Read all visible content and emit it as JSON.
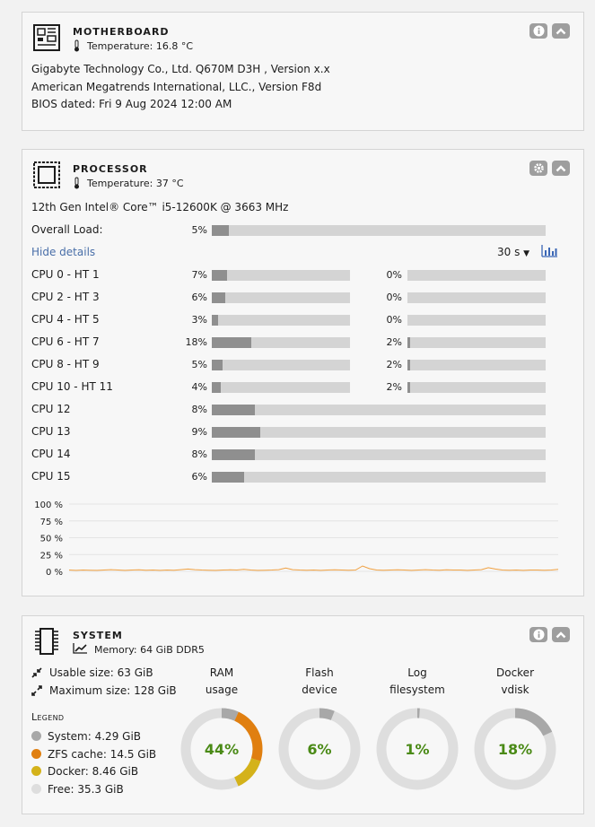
{
  "motherboard": {
    "title": "MOTHERBOARD",
    "temperature": "Temperature: 16.8 °C",
    "lines": [
      "Gigabyte Technology Co., Ltd. Q670M D3H , Version x.x",
      "American Megatrends International, LLC., Version F8d",
      "BIOS dated: Fri 9 Aug 2024 12:00 AM"
    ],
    "icons": [
      "info-icon",
      "chevron-up-icon"
    ]
  },
  "processor": {
    "title": "PROCESSOR",
    "temperature": "Temperature: 37 °C",
    "model": "12th Gen Intel® Core™ i5-12600K @ 3663 MHz",
    "overall": {
      "label": "Overall Load:",
      "pct_text": "5%",
      "value": 5
    },
    "hide_details": "Hide details",
    "interval": "30 s",
    "cpu_rows": [
      {
        "label": "CPU 0 - HT 1",
        "a_text": "7%",
        "a": 7,
        "b_text": "0%",
        "b": 0
      },
      {
        "label": "CPU 2 - HT 3",
        "a_text": "6%",
        "a": 6,
        "b_text": "0%",
        "b": 0
      },
      {
        "label": "CPU 4 - HT 5",
        "a_text": "3%",
        "a": 3,
        "b_text": "0%",
        "b": 0
      },
      {
        "label": "CPU 6 - HT 7",
        "a_text": "18%",
        "a": 18,
        "b_text": "2%",
        "b": 2
      },
      {
        "label": "CPU 8 - HT 9",
        "a_text": "5%",
        "a": 5,
        "b_text": "2%",
        "b": 2
      },
      {
        "label": "CPU 10 - HT 11",
        "a_text": "4%",
        "a": 4,
        "b_text": "2%",
        "b": 2
      }
    ],
    "cpu_single": [
      {
        "label": "CPU 12",
        "a_text": "8%",
        "a": 8
      },
      {
        "label": "CPU 13",
        "a_text": "9%",
        "a": 9
      },
      {
        "label": "CPU 14",
        "a_text": "8%",
        "a": 8
      },
      {
        "label": "CPU 15",
        "a_text": "6%",
        "a": 6
      }
    ],
    "icons": [
      "gear-icon",
      "chevron-up-icon",
      "bar-chart-icon"
    ]
  },
  "chart_data": {
    "type": "line",
    "yticks": [
      "100 %",
      "75 %",
      "50 %",
      "25 %",
      "0 %"
    ],
    "ylim": [
      0,
      100
    ],
    "grid": true,
    "series": [
      {
        "color": "#f0a040",
        "values": [
          2,
          1.5,
          2,
          1.8,
          1.5,
          2,
          2.5,
          2,
          1.5,
          2,
          2.2,
          1.8,
          2,
          1.5,
          2,
          1.8,
          2.5,
          3.5,
          2.5,
          2,
          1.8,
          1.5,
          2,
          2.2,
          2,
          3,
          2,
          1.5,
          1.8,
          2,
          2.5,
          5,
          2.5,
          2,
          1.8,
          2,
          1.5,
          2,
          2.2,
          2,
          1.8,
          2,
          8,
          4,
          2,
          1.8,
          2,
          2.2,
          2,
          1.5,
          2,
          2.5,
          2,
          1.8,
          2.2,
          2,
          2,
          1.5,
          2,
          2.5,
          5.5,
          3.5,
          2,
          1.8,
          2,
          1.5,
          2,
          2,
          1.8,
          2,
          3
        ]
      }
    ]
  },
  "system": {
    "title": "SYSTEM",
    "memory": "Memory: 64 GiB DDR5",
    "usable": "Usable size: 63 GiB",
    "maximum": "Maximum size: 128 GiB",
    "legend_title": "Legend",
    "legend": [
      {
        "text": "System: 4.29 GiB",
        "color": "#a8a8a8"
      },
      {
        "text": "ZFS cache: 14.5 GiB",
        "color": "#e07f10"
      },
      {
        "text": "Docker: 8.46 GiB",
        "color": "#d4b21a"
      },
      {
        "text": "Free: 35.3 GiB",
        "color": "#dedede"
      }
    ],
    "gauges": [
      {
        "label1": "RAM",
        "label2": "usage",
        "pct": "44%",
        "segments": [
          {
            "value": 6.8,
            "color": "#a8a8a8"
          },
          {
            "value": 23,
            "color": "#e07f10"
          },
          {
            "value": 13.4,
            "color": "#d4b21a"
          }
        ]
      },
      {
        "label1": "Flash",
        "label2": "device",
        "pct": "6%",
        "segments": [
          {
            "value": 6,
            "color": "#a8a8a8"
          }
        ]
      },
      {
        "label1": "Log",
        "label2": "filesystem",
        "pct": "1%",
        "segments": [
          {
            "value": 1,
            "color": "#a8a8a8"
          }
        ]
      },
      {
        "label1": "Docker",
        "label2": "vdisk",
        "pct": "18%",
        "segments": [
          {
            "value": 18,
            "color": "#a8a8a8"
          }
        ]
      }
    ],
    "icons": [
      "info-icon",
      "chevron-up-icon",
      "memory-chip-icon",
      "chart-line-icon",
      "shrink-arrows-icon",
      "expand-arrows-icon"
    ]
  }
}
